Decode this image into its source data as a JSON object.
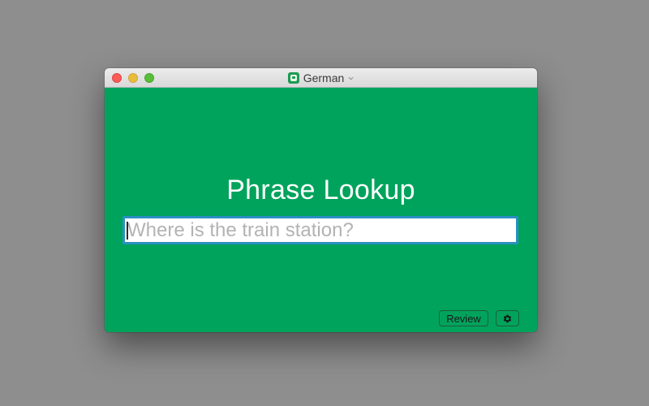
{
  "window": {
    "title": "German",
    "accent_color": "#00a35c"
  },
  "main": {
    "heading": "Phrase Lookup",
    "search": {
      "value": "",
      "placeholder": "Where is the train station?"
    },
    "review_label": "Review",
    "settings_icon": "gear-icon"
  }
}
